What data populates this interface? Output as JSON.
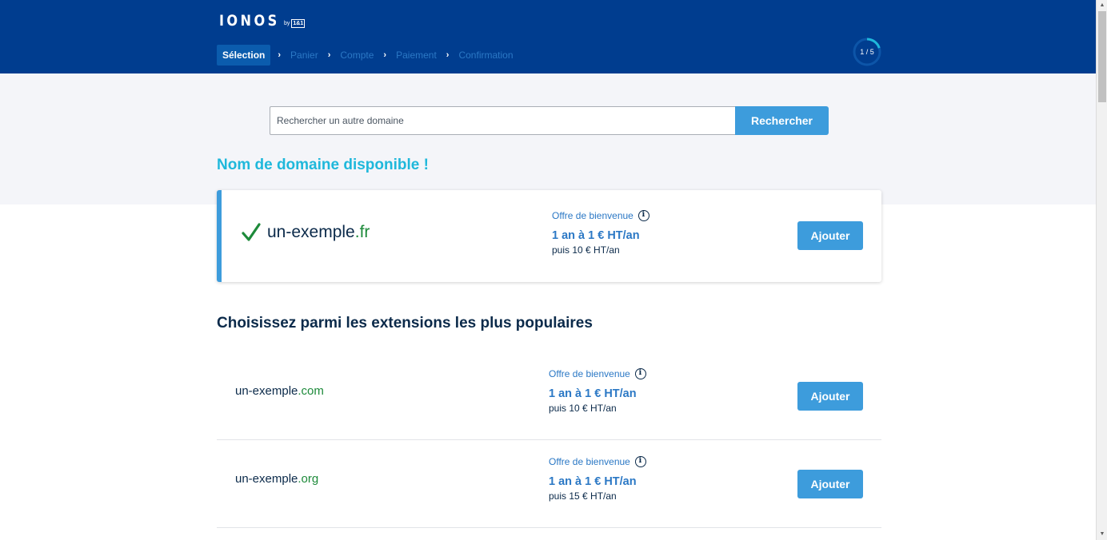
{
  "header": {
    "logo": "IONOS",
    "logo_by": "by",
    "logo_brand": "1&1",
    "steps": [
      {
        "label": "Sélection",
        "active": true
      },
      {
        "label": "Panier",
        "active": false
      },
      {
        "label": "Compte",
        "active": false
      },
      {
        "label": "Paiement",
        "active": false
      },
      {
        "label": "Confirmation",
        "active": false
      }
    ],
    "step_separator": "›",
    "progress": {
      "label": "1 / 5",
      "current": 1,
      "total": 5,
      "fraction": 0.2
    }
  },
  "search": {
    "placeholder": "Rechercher un autre domaine",
    "value": "",
    "button_label": "Rechercher"
  },
  "available": {
    "title": "Nom de domaine disponible !",
    "domain_name": "un-exemple",
    "domain_tld": ".fr",
    "offer_label": "Offre de bienvenue",
    "price_main": "1 an à 1 € HT/an",
    "price_after": "puis 10 € HT/an",
    "button_label": "Ajouter"
  },
  "popular": {
    "title": "Choisissez parmi les extensions les plus populaires",
    "items": [
      {
        "domain_name": "un-exemple",
        "domain_tld": ".com",
        "offer_label": "Offre de bienvenue",
        "price_main": "1 an à 1 € HT/an",
        "price_after": "puis 10 € HT/an",
        "button_label": "Ajouter"
      },
      {
        "domain_name": "un-exemple",
        "domain_tld": ".org",
        "offer_label": "Offre de bienvenue",
        "price_main": "1 an à 1 € HT/an",
        "price_after": "puis 15 € HT/an",
        "button_label": "Ajouter"
      }
    ]
  },
  "colors": {
    "header_bg": "#003d8f",
    "accent_blue": "#3d9cdc",
    "available_title": "#1fb8db",
    "tld_green": "#1d8a3a",
    "check_green": "#1d8a3a"
  }
}
